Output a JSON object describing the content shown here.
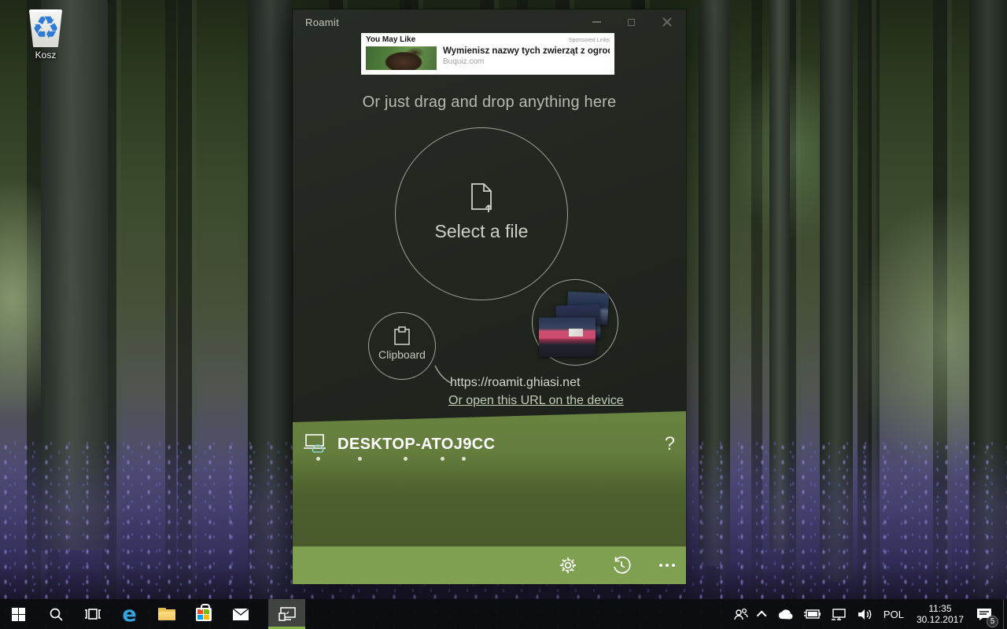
{
  "desktop": {
    "recycle_bin_label": "Kosz"
  },
  "window": {
    "title": "Roamit",
    "ad": {
      "section": "You May Like",
      "sponsored": "Sponsored Links",
      "headline": "Wymienisz nazwy tych zwierząt z ogrodów zoo...",
      "source": "Buquiz.com"
    },
    "drop_hint": "Or just drag and drop anything here",
    "select_file_label": "Select a file",
    "clipboard_label": "Clipboard",
    "share_url": "https://roamit.ghiasi.net",
    "open_url_link": "Or open this URL on the device",
    "device": {
      "name": "DESKTOP-ATOJ9CC",
      "help": "?"
    },
    "colors": {
      "device_bar_green": "#66803f",
      "dark_green": "#4a5c2d",
      "bottom_bar_green": "#7fa050",
      "app_background": "#21261f"
    }
  },
  "taskbar": {
    "language": "POL",
    "time": "11:35",
    "date": "30.12.2017",
    "notifications": "5",
    "active_app": "Roamit",
    "active_underline_color": "#86b24a"
  }
}
